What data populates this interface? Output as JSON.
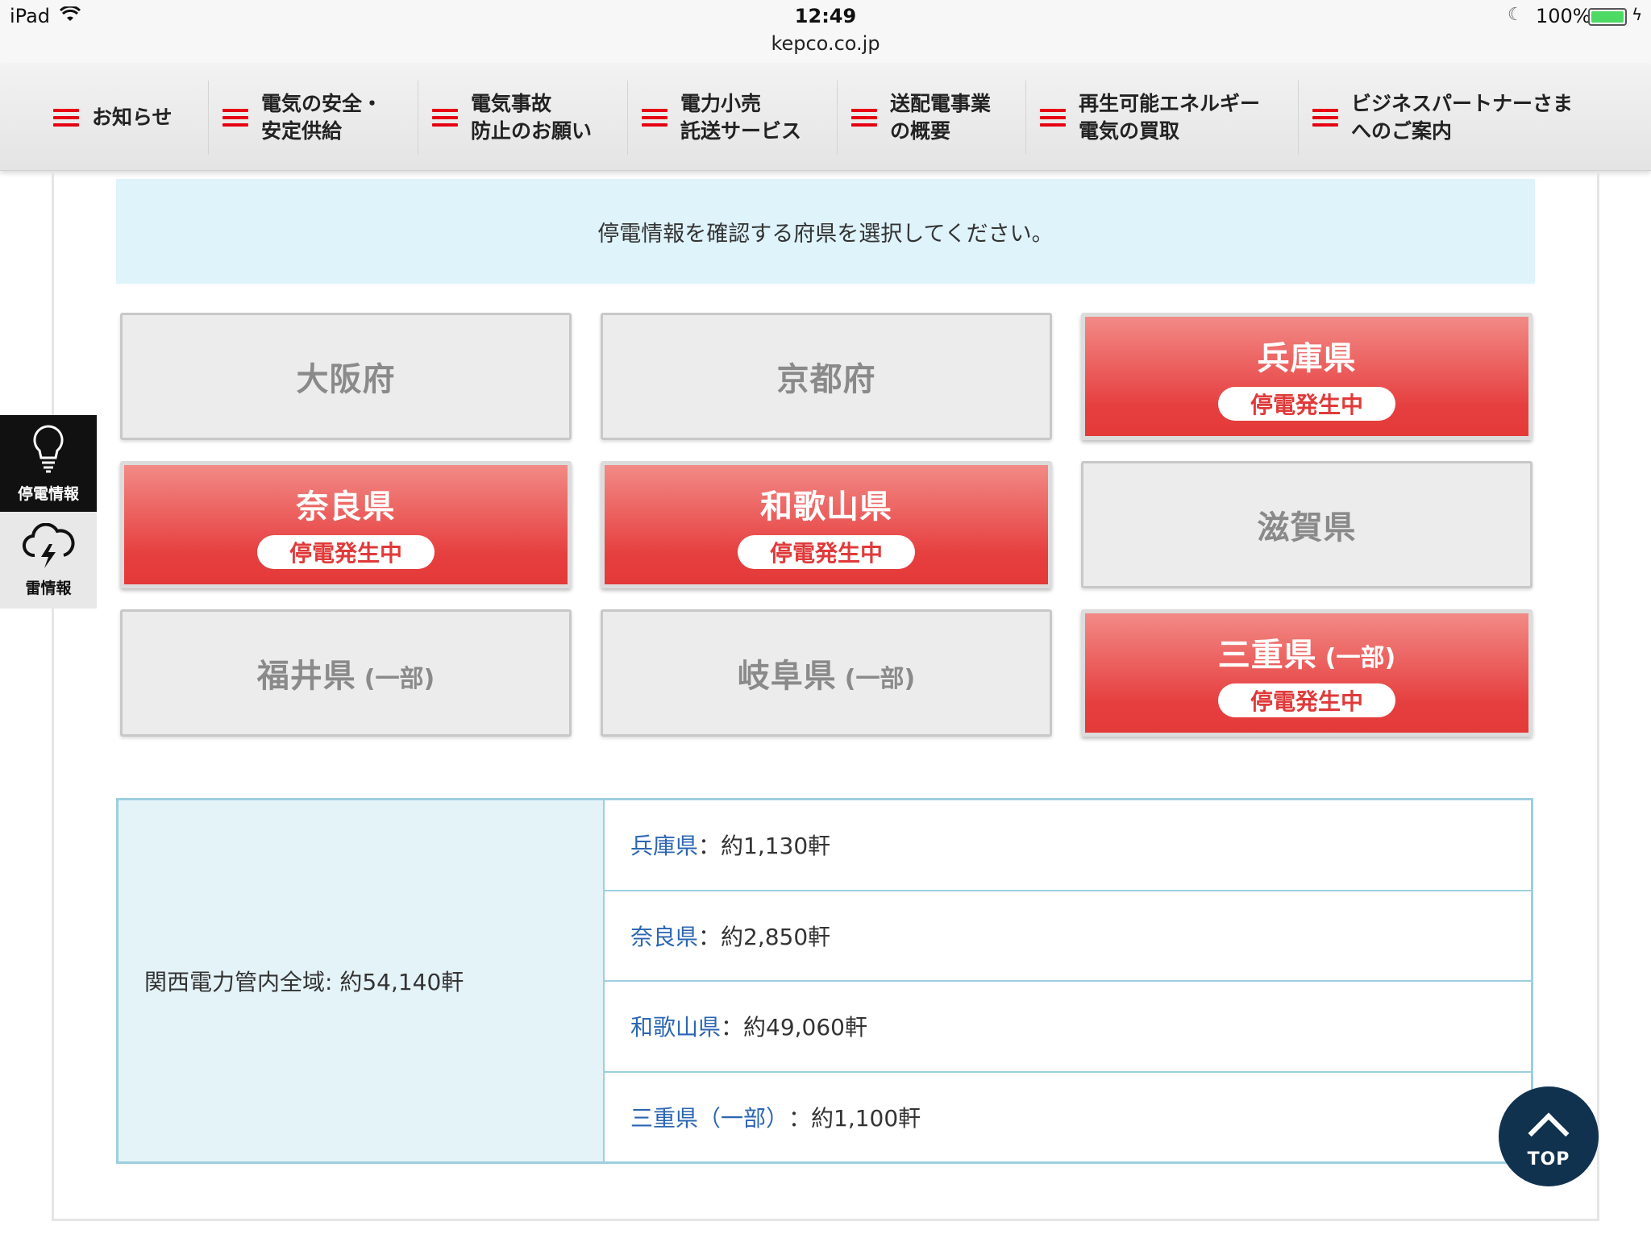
{
  "status_bar": {
    "device": "iPad",
    "time": "12:49",
    "url": "kepco.co.jp",
    "battery": "100%"
  },
  "nav": {
    "items": [
      {
        "label": "お知らせ"
      },
      {
        "label": "電気の安全・\n安定供給"
      },
      {
        "label": "電気事故\n防止のお願い"
      },
      {
        "label": "電力小売\n託送サービス"
      },
      {
        "label": "送配電事業\nの概要"
      },
      {
        "label": "再生可能エネルギー\n電気の買取"
      },
      {
        "label": "ビジネスパートナーさま\nへのご案内"
      }
    ]
  },
  "instruction": "停電情報を確認する府県を選択してください。",
  "prefectures": [
    {
      "name": "大阪府",
      "note": "",
      "status": ""
    },
    {
      "name": "京都府",
      "note": "",
      "status": ""
    },
    {
      "name": "兵庫県",
      "note": "",
      "status": "停電発生中"
    },
    {
      "name": "奈良県",
      "note": "",
      "status": "停電発生中"
    },
    {
      "name": "和歌山県",
      "note": "",
      "status": "停電発生中"
    },
    {
      "name": "滋賀県",
      "note": "",
      "status": ""
    },
    {
      "name": "福井県",
      "note": "(一部)",
      "status": ""
    },
    {
      "name": "岐阜県",
      "note": "(一部)",
      "status": ""
    },
    {
      "name": "三重県",
      "note": "(一部)",
      "status": "停電発生中"
    }
  ],
  "side_widget": {
    "outage_label": "停電情報",
    "thunder_label": "雷情報"
  },
  "summary": {
    "total": "関西電力管内全域: 約54,140軒",
    "rows": [
      {
        "pref": "兵庫県",
        "count": "：約1,130軒"
      },
      {
        "pref": "奈良県",
        "count": "：約2,850軒"
      },
      {
        "pref": "和歌山県",
        "count": "：約49,060軒"
      },
      {
        "pref": "三重県（一部）",
        "count": "：約1,100軒"
      }
    ]
  },
  "top_button": "TOP",
  "colors": {
    "accent_red": "#e60012",
    "outage_red": "#e43939",
    "info_bg": "#dff3fa",
    "link_blue": "#2b66b2",
    "top_button": "#10324e"
  }
}
